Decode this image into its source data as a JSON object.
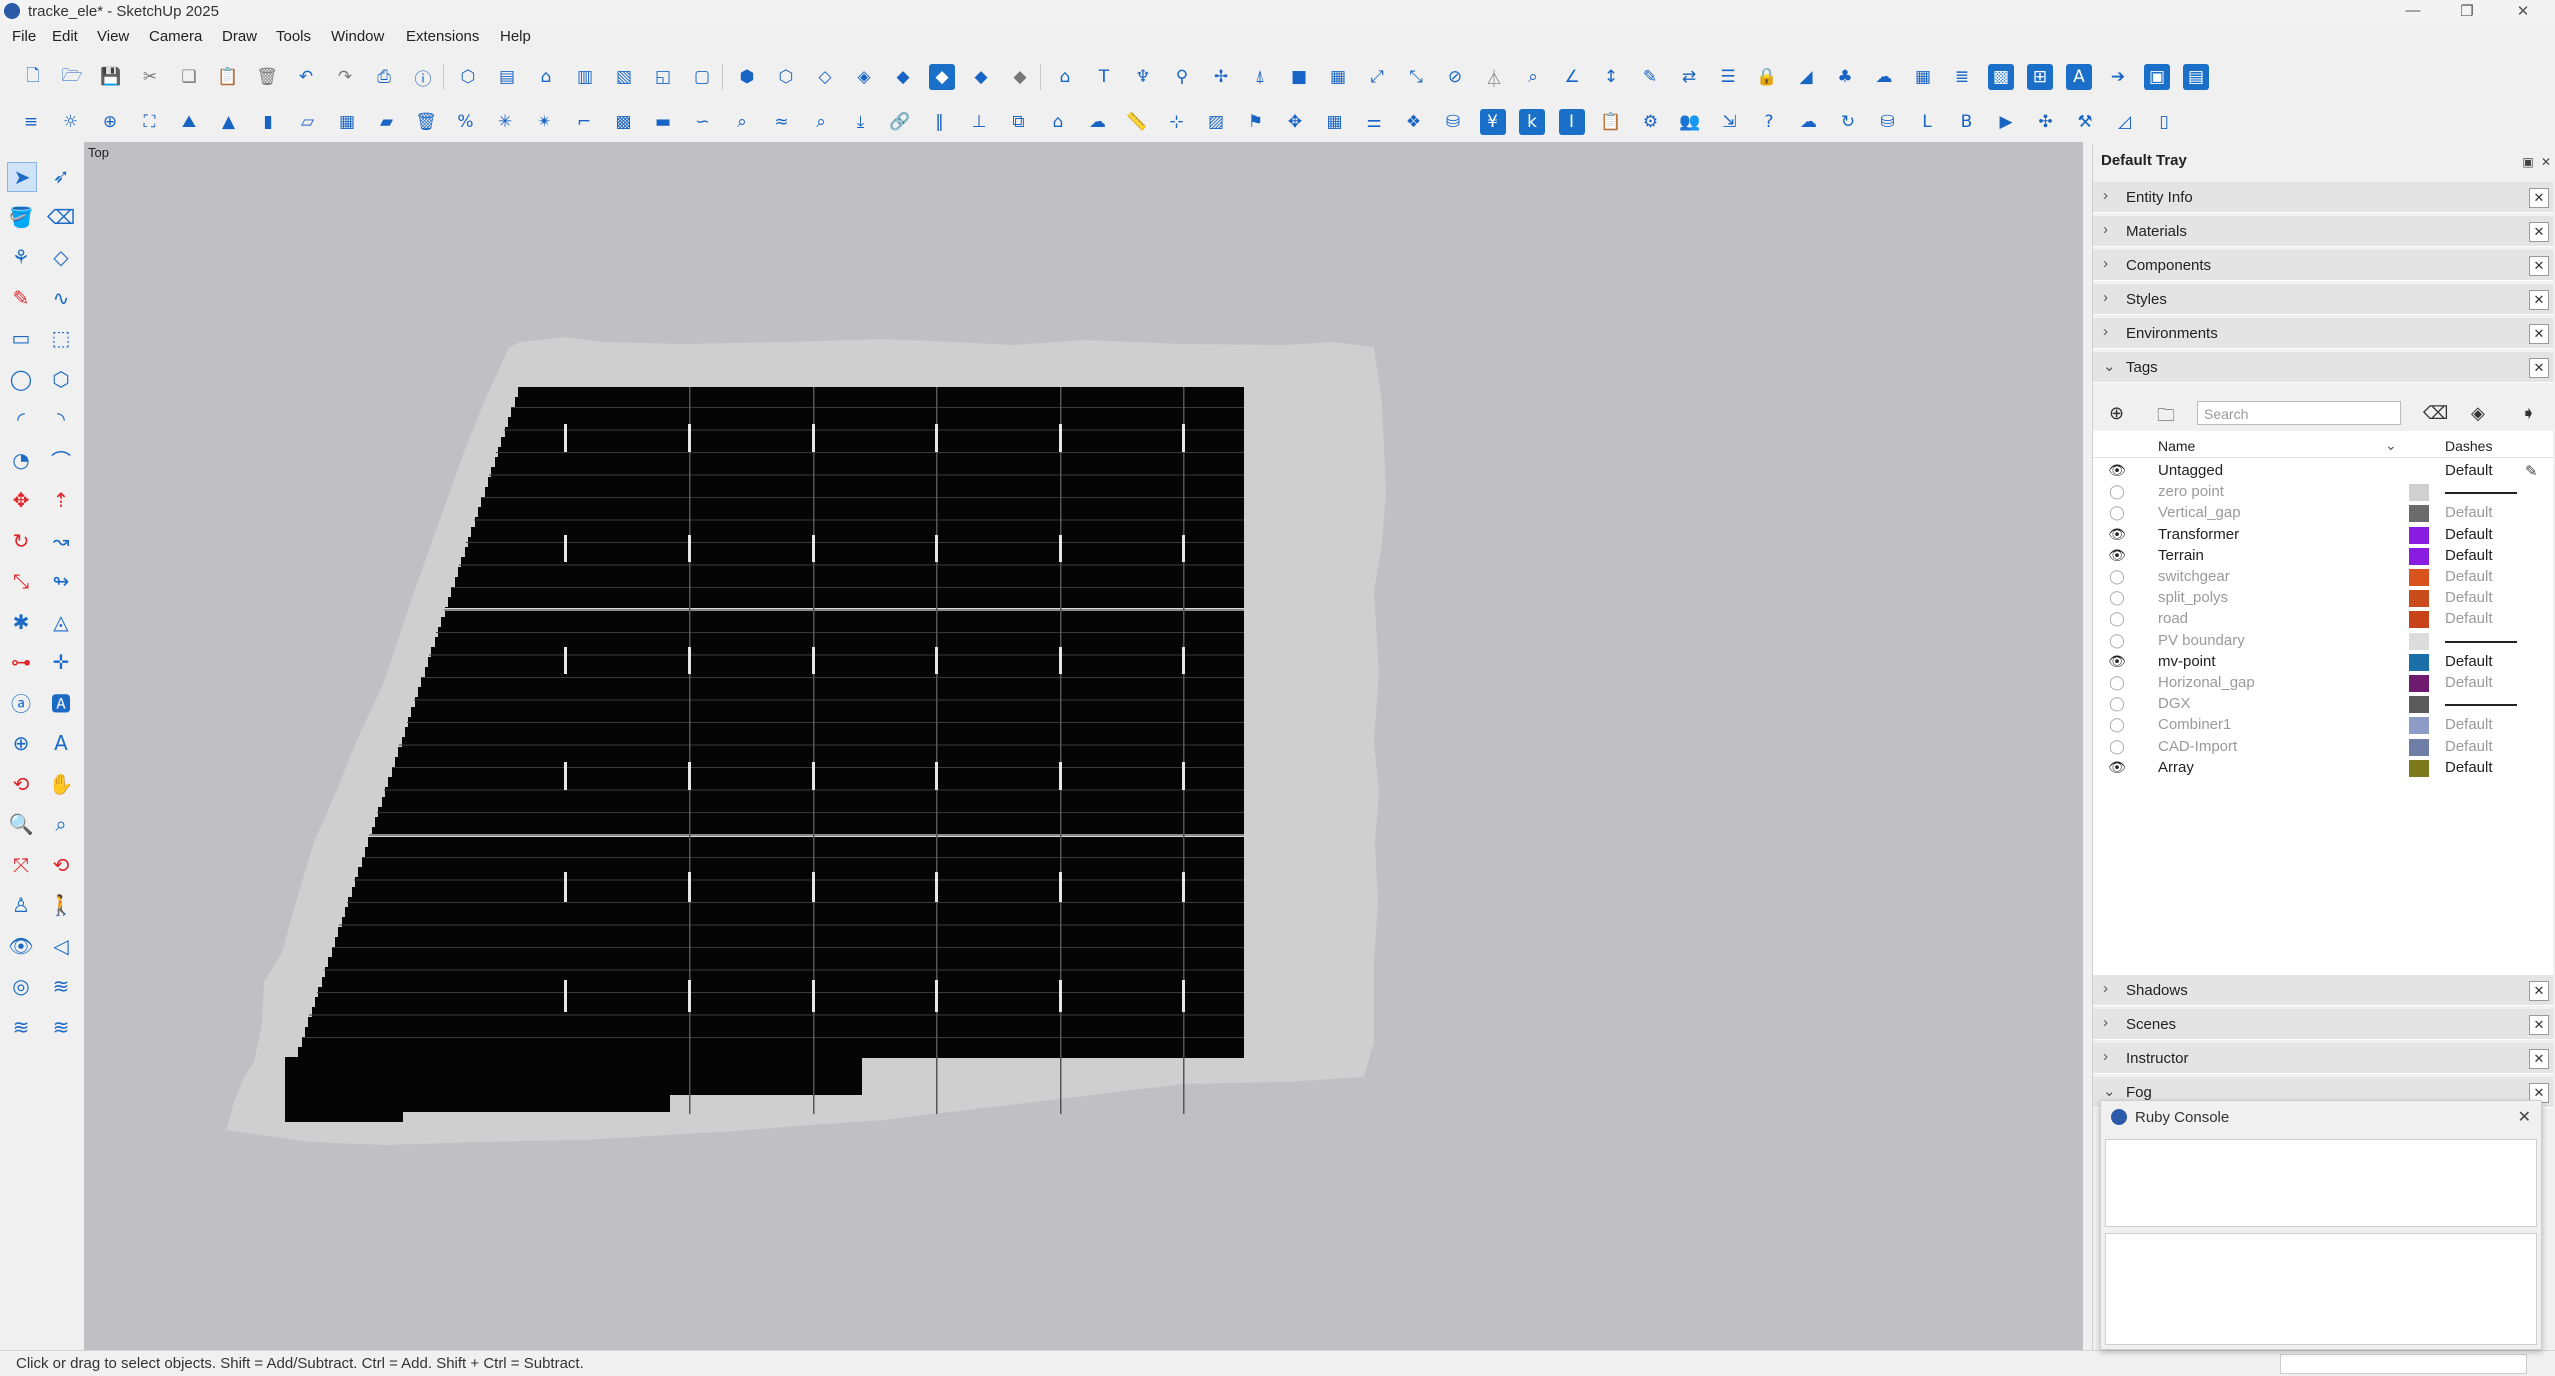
{
  "window": {
    "title": "tracke_ele* - SketchUp 2025",
    "controls": [
      "—",
      "❐",
      "✕"
    ]
  },
  "menu": [
    "File",
    "Edit",
    "View",
    "Camera",
    "Draw",
    "Tools",
    "Window",
    "Extensions",
    "Help"
  ],
  "viewport": {
    "view_label": "Top",
    "colors": {
      "background": "#bfbfc4",
      "terrain": "#cfcfcf",
      "array": "#050505"
    }
  },
  "status": {
    "hint": "Click or drag to select objects. Shift = Add/Subtract. Ctrl = Add. Shift + Ctrl = Subtract."
  },
  "tray": {
    "title": "Default Tray",
    "panels_top": [
      "Entity Info",
      "Materials",
      "Components",
      "Styles",
      "Environments"
    ],
    "tags_panel": {
      "title": "Tags",
      "search_placeholder": "Search",
      "col_name": "Name",
      "col_dashes": "Dashes",
      "rows": [
        {
          "name": "Untagged",
          "visible": true,
          "color": "",
          "dashes": "Default"
        },
        {
          "name": "zero point",
          "visible": false,
          "color": "#d0d0d0",
          "dashes": "line"
        },
        {
          "name": "Vertical_gap",
          "visible": false,
          "color": "#6b6b6b",
          "dashes": "Default"
        },
        {
          "name": "Transformer",
          "visible": true,
          "color": "#8a1be0",
          "dashes": "Default"
        },
        {
          "name": "Terrain",
          "visible": true,
          "color": "#8a1be0",
          "dashes": "Default"
        },
        {
          "name": "switchgear",
          "visible": false,
          "color": "#d9531e",
          "dashes": "Default"
        },
        {
          "name": "split_polys",
          "visible": false,
          "color": "#c94a1a",
          "dashes": "Default"
        },
        {
          "name": "road",
          "visible": false,
          "color": "#c9431a",
          "dashes": "Default"
        },
        {
          "name": "PV boundary",
          "visible": false,
          "color": "#dcdcdc",
          "dashes": "line"
        },
        {
          "name": "mv-point",
          "visible": true,
          "color": "#1b6fa8",
          "dashes": "Default"
        },
        {
          "name": "Horizonal_gap",
          "visible": false,
          "color": "#6e1a6e",
          "dashes": "Default"
        },
        {
          "name": "DGX",
          "visible": false,
          "color": "#5a5a5a",
          "dashes": "line"
        },
        {
          "name": "Combiner1",
          "visible": false,
          "color": "#8e9bc7",
          "dashes": "Default"
        },
        {
          "name": "CAD-Import",
          "visible": false,
          "color": "#6f7ea6",
          "dashes": "Default"
        },
        {
          "name": "Array",
          "visible": true,
          "color": "#7d7a1b",
          "dashes": "Default"
        }
      ]
    },
    "panels_bottom": [
      "Shadows",
      "Scenes",
      "Instructor",
      "Fog"
    ]
  },
  "ruby_console": {
    "title": "Ruby Console"
  },
  "toolbar": {
    "row1": [
      {
        "name": "new-file-icon",
        "glyph": "🗋",
        "style": ""
      },
      {
        "name": "open-folder-icon",
        "glyph": "🗁",
        "style": ""
      },
      {
        "name": "save-icon",
        "glyph": "💾",
        "style": ""
      },
      {
        "name": "cut-icon",
        "glyph": "✂",
        "style": "gray"
      },
      {
        "name": "copy-icon",
        "glyph": "❏",
        "style": "gray"
      },
      {
        "name": "paste-icon",
        "glyph": "📋",
        "style": "gray"
      },
      {
        "name": "delete-icon",
        "glyph": "🗑",
        "style": "gray"
      },
      {
        "name": "undo-icon",
        "glyph": "↶",
        "style": ""
      },
      {
        "name": "redo-icon",
        "glyph": "↷",
        "style": "gray"
      },
      {
        "name": "print-icon",
        "glyph": "⎙",
        "style": ""
      },
      {
        "name": "model-info-icon",
        "glyph": "ⓘ",
        "style": ""
      },
      {
        "name": "iso-view-icon",
        "glyph": "⬡",
        "style": ""
      },
      {
        "name": "top-view-icon",
        "glyph": "▤",
        "style": ""
      },
      {
        "name": "front-view-icon",
        "glyph": "⌂",
        "style": ""
      },
      {
        "name": "right-view-icon",
        "glyph": "▥",
        "style": ""
      },
      {
        "name": "back-view-icon",
        "glyph": "▧",
        "style": ""
      },
      {
        "name": "left-view-icon",
        "glyph": "◱",
        "style": ""
      },
      {
        "name": "bottom-view-icon",
        "glyph": "▢",
        "style": ""
      },
      {
        "name": "xray-icon",
        "glyph": "⬢",
        "style": ""
      },
      {
        "name": "back-edges-icon",
        "glyph": "⬡",
        "style": ""
      },
      {
        "name": "wireframe-icon",
        "glyph": "◇",
        "style": ""
      },
      {
        "name": "hidden-line-icon",
        "glyph": "◈",
        "style": ""
      },
      {
        "name": "shaded-icon",
        "glyph": "◆",
        "style": ""
      },
      {
        "name": "shaded-textures-icon",
        "glyph": "◆",
        "style": "fill"
      },
      {
        "name": "monochrome-icon",
        "glyph": "◆",
        "style": ""
      },
      {
        "name": "hidden-geometry-icon",
        "glyph": "◆",
        "style": "gray"
      },
      {
        "name": "warehouse-icon",
        "glyph": "⌂",
        "style": ""
      },
      {
        "name": "text-icon",
        "glyph": "T",
        "style": ""
      },
      {
        "name": "tower-icon",
        "glyph": "♆",
        "style": ""
      },
      {
        "name": "pin-icon",
        "glyph": "⚲",
        "style": ""
      },
      {
        "name": "axes-icon",
        "glyph": "✢",
        "style": ""
      },
      {
        "name": "pylon-icon",
        "glyph": "⍋",
        "style": ""
      },
      {
        "name": "box-icon",
        "glyph": "■",
        "style": ""
      },
      {
        "name": "grid-icon",
        "glyph": "▦",
        "style": ""
      },
      {
        "name": "scale-icon",
        "glyph": "⤢",
        "style": ""
      },
      {
        "name": "expand-icon",
        "glyph": "⤡",
        "style": ""
      },
      {
        "name": "hide-icon",
        "glyph": "⊘",
        "style": ""
      },
      {
        "name": "filter-icon",
        "glyph": "⏃",
        "style": "gray"
      },
      {
        "name": "search-icon",
        "glyph": "⌕",
        "style": ""
      },
      {
        "name": "angle-icon",
        "glyph": "∠",
        "style": ""
      },
      {
        "name": "dimension-icon",
        "glyph": "↕",
        "style": ""
      },
      {
        "name": "edit-line-icon",
        "glyph": "✎",
        "style": ""
      },
      {
        "name": "swap-icon",
        "glyph": "⇄",
        "style": ""
      },
      {
        "name": "list-icon",
        "glyph": "☰",
        "style": ""
      },
      {
        "name": "lock-icon",
        "glyph": "🔒",
        "style": ""
      },
      {
        "name": "slope-icon",
        "glyph": "◢",
        "style": ""
      },
      {
        "name": "tree-icon",
        "glyph": "♣",
        "style": ""
      },
      {
        "name": "cloud-icon",
        "glyph": "☁",
        "style": ""
      },
      {
        "name": "table-icon",
        "glyph": "▦",
        "style": ""
      },
      {
        "name": "layers-icon",
        "glyph": "≣",
        "style": ""
      },
      {
        "name": "grid-fill-icon",
        "glyph": "▩",
        "style": "fill"
      },
      {
        "name": "merge-icon",
        "glyph": "⊞",
        "style": "fill"
      },
      {
        "name": "auto-icon",
        "glyph": "A",
        "style": "fill"
      },
      {
        "name": "arrow-forward-icon",
        "glyph": "➔",
        "style": ""
      },
      {
        "name": "matrix-icon",
        "glyph": "▣",
        "style": "fill"
      },
      {
        "name": "block-icon",
        "glyph": "▤",
        "style": "fill"
      }
    ],
    "row2": [
      {
        "name": "menu-list-icon",
        "glyph": "≡",
        "style": ""
      },
      {
        "name": "sun-icon",
        "glyph": "☼",
        "style": ""
      },
      {
        "name": "globe-icon",
        "glyph": "⊕",
        "style": ""
      },
      {
        "name": "frame-icon",
        "glyph": "⛶",
        "style": ""
      },
      {
        "name": "sandbox-icon",
        "glyph": "⛰",
        "style": ""
      },
      {
        "name": "terrain-icon",
        "glyph": "▲",
        "style": ""
      },
      {
        "name": "panel-icon",
        "glyph": "▮",
        "style": ""
      },
      {
        "name": "module-icon",
        "glyph": "▱",
        "style": ""
      },
      {
        "name": "array-grid-icon",
        "glyph": "▦",
        "style": ""
      },
      {
        "name": "row-icon",
        "glyph": "▰",
        "style": ""
      },
      {
        "name": "trash-icon",
        "glyph": "🗑",
        "style": ""
      },
      {
        "name": "percent-icon",
        "glyph": "%",
        "style": ""
      },
      {
        "name": "spark-icon",
        "glyph": "✳",
        "style": ""
      },
      {
        "name": "spark2-icon",
        "glyph": "✴",
        "style": ""
      },
      {
        "name": "pipe-icon",
        "glyph": "⌐",
        "style": ""
      },
      {
        "name": "qr-icon",
        "glyph": "▩",
        "style": ""
      },
      {
        "name": "chip-icon",
        "glyph": "▬",
        "style": ""
      },
      {
        "name": "route-icon",
        "glyph": "∽",
        "style": ""
      },
      {
        "name": "zoom-area-icon",
        "glyph": "⌕",
        "style": ""
      },
      {
        "name": "wave-icon",
        "glyph": "≈",
        "style": ""
      },
      {
        "name": "zoom-ext-icon",
        "glyph": "⌕",
        "style": ""
      },
      {
        "name": "download-icon",
        "glyph": "⤓",
        "style": ""
      },
      {
        "name": "link-icon",
        "glyph": "🔗",
        "style": ""
      },
      {
        "name": "fence-icon",
        "glyph": "‖",
        "style": ""
      },
      {
        "name": "axis-icon",
        "glyph": "⊥",
        "style": ""
      },
      {
        "name": "cube-out-icon",
        "glyph": "⧉",
        "style": ""
      },
      {
        "name": "house-plus-icon",
        "glyph": "⌂",
        "style": ""
      },
      {
        "name": "cloud-cad-icon",
        "glyph": "☁",
        "style": ""
      },
      {
        "name": "ruler-icon",
        "glyph": "📏",
        "style": ""
      },
      {
        "name": "node-icon",
        "glyph": "⊹",
        "style": ""
      },
      {
        "name": "image-icon",
        "glyph": "▨",
        "style": ""
      },
      {
        "name": "flag-icon",
        "glyph": "⚑",
        "style": ""
      },
      {
        "name": "move-icon",
        "glyph": "✥",
        "style": ""
      },
      {
        "name": "calc-icon",
        "glyph": "▦",
        "style": ""
      },
      {
        "name": "sliders-icon",
        "glyph": "⚌",
        "style": ""
      },
      {
        "name": "dropbox-icon",
        "glyph": "❖",
        "style": ""
      },
      {
        "name": "db-icon",
        "glyph": "⛁",
        "style": ""
      },
      {
        "name": "yen-icon",
        "glyph": "¥",
        "style": "fill"
      },
      {
        "name": "kwh-icon",
        "glyph": "k",
        "style": "fill"
      },
      {
        "name": "irr-icon",
        "glyph": "I",
        "style": "fill"
      },
      {
        "name": "clipboard-icon",
        "glyph": "📋",
        "style": ""
      },
      {
        "name": "gear-icon",
        "glyph": "⚙",
        "style": ""
      },
      {
        "name": "users-icon",
        "glyph": "👥",
        "style": ""
      },
      {
        "name": "export-icon",
        "glyph": "⇲",
        "style": ""
      },
      {
        "name": "help-icon",
        "glyph": "?",
        "style": ""
      },
      {
        "name": "upload-cloud-icon",
        "glyph": "☁",
        "style": ""
      },
      {
        "name": "refresh-icon",
        "glyph": "↻",
        "style": ""
      },
      {
        "name": "stack-icon",
        "glyph": "⛁",
        "style": ""
      },
      {
        "name": "loss-icon",
        "glyph": "L",
        "style": ""
      },
      {
        "name": "bi-icon",
        "glyph": "B",
        "style": ""
      },
      {
        "name": "play-icon",
        "glyph": "▶",
        "style": ""
      },
      {
        "name": "scatter-icon",
        "glyph": "✣",
        "style": ""
      },
      {
        "name": "tools-icon",
        "glyph": "⚒",
        "style": ""
      },
      {
        "name": "chart-icon",
        "glyph": "◿",
        "style": ""
      },
      {
        "name": "obj-icon",
        "glyph": "▯",
        "style": ""
      }
    ]
  },
  "left_tools": [
    {
      "name": "select-icon",
      "glyph": "➤",
      "style": "active"
    },
    {
      "name": "lasso-icon",
      "glyph": "➶",
      "style": ""
    },
    {
      "name": "paint-bucket-icon",
      "glyph": "🪣",
      "style": ""
    },
    {
      "name": "eraser-icon",
      "glyph": "⌫",
      "style": ""
    },
    {
      "name": "component-icon",
      "glyph": "⚘",
      "style": ""
    },
    {
      "name": "tag-icon",
      "glyph": "◇",
      "style": ""
    },
    {
      "name": "pencil-icon",
      "glyph": "✎",
      "style": "red"
    },
    {
      "name": "freehand-icon",
      "glyph": "∿",
      "style": ""
    },
    {
      "name": "rectangle-icon",
      "glyph": "▭",
      "style": ""
    },
    {
      "name": "rotated-rect-icon",
      "glyph": "⬚",
      "style": ""
    },
    {
      "name": "circle-icon",
      "glyph": "◯",
      "style": ""
    },
    {
      "name": "polygon-icon",
      "glyph": "⬡",
      "style": ""
    },
    {
      "name": "arc-icon",
      "glyph": "◜",
      "style": ""
    },
    {
      "name": "arc2-icon",
      "glyph": "◝",
      "style": ""
    },
    {
      "name": "pie-icon",
      "glyph": "◔",
      "style": ""
    },
    {
      "name": "arc3-icon",
      "glyph": "⌒",
      "style": ""
    },
    {
      "name": "move-tool-icon",
      "glyph": "✥",
      "style": "red"
    },
    {
      "name": "push-pull-icon",
      "glyph": "⇡",
      "style": "red"
    },
    {
      "name": "rotate-icon",
      "glyph": "↻",
      "style": "red"
    },
    {
      "name": "follow-me-icon",
      "glyph": "↝",
      "style": ""
    },
    {
      "name": "scale-tool-icon",
      "glyph": "⤡",
      "style": "red"
    },
    {
      "name": "offset-icon",
      "glyph": "↬",
      "style": ""
    },
    {
      "name": "tape-icon",
      "glyph": "✱",
      "style": ""
    },
    {
      "name": "protractor-icon",
      "glyph": "◬",
      "style": ""
    },
    {
      "name": "dimension-tool-icon",
      "glyph": "⊶",
      "style": "red"
    },
    {
      "name": "axes-tool-icon",
      "glyph": "✛",
      "style": ""
    },
    {
      "name": "3d-text-icon",
      "glyph": "ⓐ",
      "style": ""
    },
    {
      "name": "label-icon",
      "glyph": "🅰",
      "style": ""
    },
    {
      "name": "section-icon",
      "glyph": "⊕",
      "style": ""
    },
    {
      "name": "text3d-icon",
      "glyph": "A",
      "style": ""
    },
    {
      "name": "orbit-icon",
      "glyph": "⟲",
      "style": "red"
    },
    {
      "name": "pan-icon",
      "glyph": "✋",
      "style": ""
    },
    {
      "name": "zoom-icon",
      "glyph": "🔍",
      "style": ""
    },
    {
      "name": "zoom-window-icon",
      "glyph": "⌕",
      "style": ""
    },
    {
      "name": "zoom-extents-icon",
      "glyph": "⤧",
      "style": "red"
    },
    {
      "name": "previous-view-icon",
      "glyph": "⟲",
      "style": "red"
    },
    {
      "name": "position-camera-icon",
      "glyph": "♙",
      "style": ""
    },
    {
      "name": "walk-icon",
      "glyph": "🚶",
      "style": ""
    },
    {
      "name": "look-around-icon",
      "glyph": "👁",
      "style": ""
    },
    {
      "name": "section-plane-icon",
      "glyph": "◁",
      "style": ""
    },
    {
      "name": "sandbox-contour-icon",
      "glyph": "◎",
      "style": ""
    },
    {
      "name": "sandbox-scratch-icon",
      "glyph": "≋",
      "style": ""
    },
    {
      "name": "smoove-icon",
      "glyph": "≋",
      "style": ""
    },
    {
      "name": "stamp-icon",
      "glyph": "≋",
      "style": ""
    }
  ]
}
